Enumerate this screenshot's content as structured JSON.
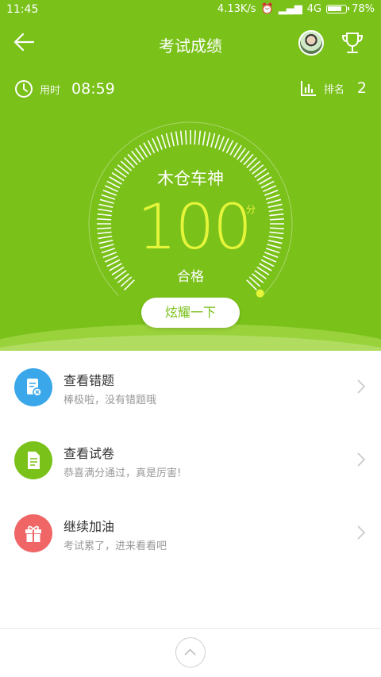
{
  "status_bar": {
    "time": "11:45",
    "network_speed": "4.13K/s",
    "network_type": "4G",
    "battery": "78%"
  },
  "header": {
    "title": "考试成绩",
    "back_icon": "arrow-left-icon",
    "trophy_icon": "trophy-icon"
  },
  "stats": {
    "time_label": "用时",
    "time_value": "08:59",
    "rank_label": "排名",
    "rank_value": "2"
  },
  "result": {
    "grade_title": "木仓车神",
    "score": "100",
    "score_unit": "分",
    "status": "合格",
    "share_button": "炫耀一下",
    "progress_fraction": 1.0
  },
  "menu": [
    {
      "title": "查看错题",
      "subtitle": "棒极啦，没有错题哦",
      "color": "#3aa7ea",
      "icon": "wrong-questions-icon"
    },
    {
      "title": "查看试卷",
      "subtitle": "恭喜满分通过，真是厉害!",
      "color": "#7ac11a",
      "icon": "document-icon"
    },
    {
      "title": "继续加油",
      "subtitle": "考试累了，进来看看吧",
      "color": "#f06666",
      "icon": "gift-icon"
    }
  ],
  "colors": {
    "primary": "#7ac11a",
    "score": "#e5f53a"
  }
}
